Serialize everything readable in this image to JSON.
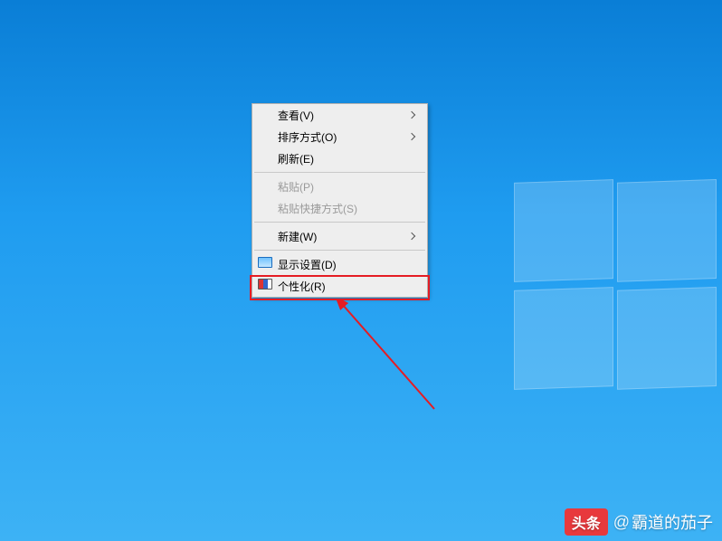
{
  "context_menu": {
    "items": [
      {
        "label": "查看(V)",
        "submenu": true,
        "enabled": true
      },
      {
        "label": "排序方式(O)",
        "submenu": true,
        "enabled": true
      },
      {
        "label": "刷新(E)",
        "submenu": false,
        "enabled": true
      }
    ],
    "items2": [
      {
        "label": "粘贴(P)",
        "submenu": false,
        "enabled": false
      },
      {
        "label": "粘贴快捷方式(S)",
        "submenu": false,
        "enabled": false
      }
    ],
    "items3": [
      {
        "label": "新建(W)",
        "submenu": true,
        "enabled": true
      }
    ],
    "items4": [
      {
        "label": "显示设置(D)",
        "submenu": false,
        "enabled": true,
        "icon": "display"
      },
      {
        "label": "个性化(R)",
        "submenu": false,
        "enabled": true,
        "icon": "personalize"
      }
    ]
  },
  "watermark": {
    "brand": "头条",
    "at": "@",
    "author": "霸道的茄子"
  }
}
